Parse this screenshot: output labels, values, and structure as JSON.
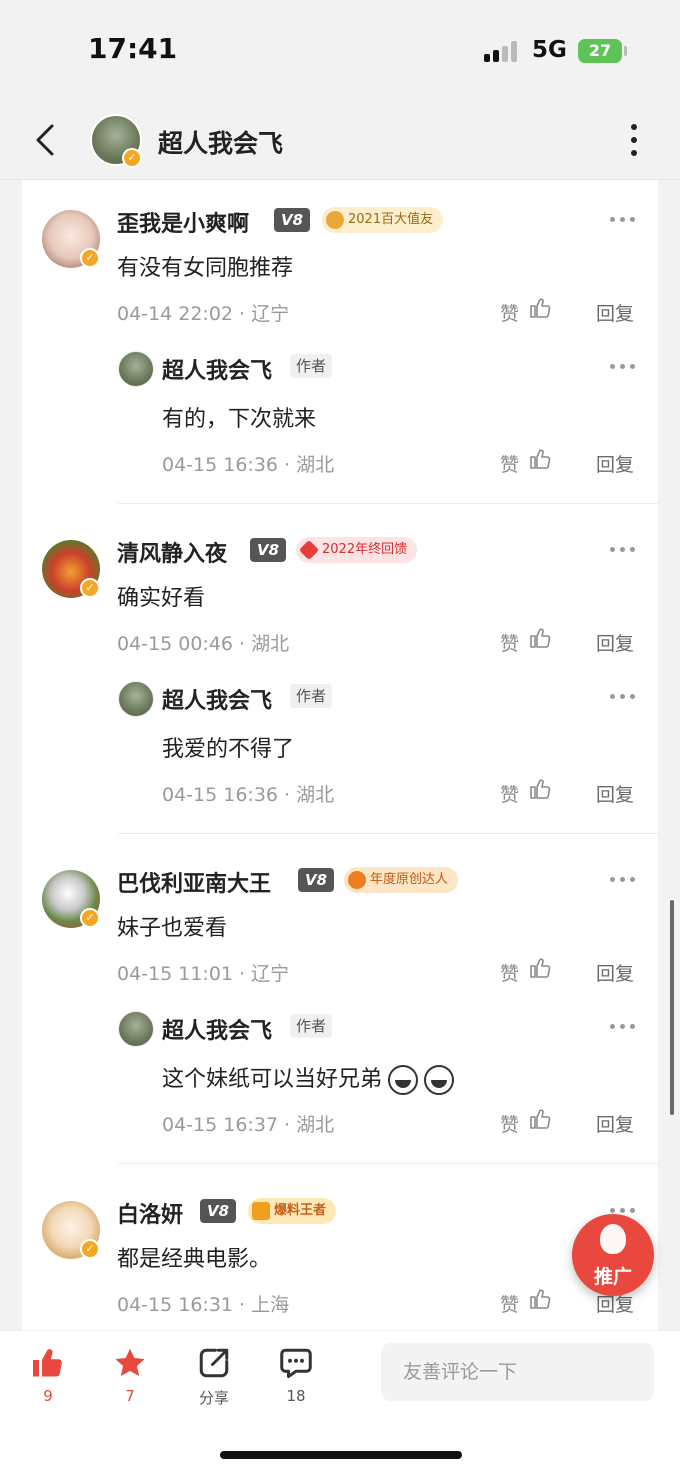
{
  "status_bar": {
    "time": "17:41",
    "network": "5G",
    "battery": "27"
  },
  "header": {
    "title": "超人我会飞"
  },
  "labels": {
    "author_tag": "作者",
    "like": "赞",
    "reply": "回复"
  },
  "comments": [
    {
      "name": "歪我是小爽啊",
      "level": "V8",
      "medal": "2021百大值友",
      "text": "有没有女同胞推荐",
      "time": "04-14 22:02",
      "location": "辽宁",
      "reply": {
        "name": "超人我会飞",
        "text": "有的，下次就来",
        "time": "04-15 16:36",
        "location": "湖北"
      }
    },
    {
      "name": "清风静入夜",
      "level": "V8",
      "medal": "2022年终回馈",
      "text": "确实好看",
      "time": "04-15 00:46",
      "location": "湖北",
      "reply": {
        "name": "超人我会飞",
        "text": "我爱的不得了",
        "time": "04-15 16:36",
        "location": "湖北"
      }
    },
    {
      "name": "巴伐利亚南大王",
      "level": "V8",
      "medal": "年度原创达人",
      "text": "妹子也爱看",
      "time": "04-15 11:01",
      "location": "辽宁",
      "reply": {
        "name": "超人我会飞",
        "text": "这个妹纸可以当好兄弟",
        "time": "04-15 16:37",
        "location": "湖北"
      }
    },
    {
      "name": "白洛妍",
      "level": "V8",
      "medal": "爆料王者",
      "text": "都是经典电影。",
      "time": "04-15 16:31",
      "location": "上海"
    }
  ],
  "fab": {
    "label": "推广"
  },
  "bottom_bar": {
    "like_count": "9",
    "favorite_count": "7",
    "share_label": "分享",
    "comment_count": "18",
    "input_placeholder": "友善评论一下"
  },
  "colors": {
    "accent": "#e8483d",
    "medal_gold": "#e8a838",
    "verified": "#f5a623"
  },
  "icons": [
    "back-icon",
    "more-vertical-icon",
    "more-horizontal-icon",
    "thumb-up-icon",
    "star-icon",
    "share-icon",
    "comment-icon"
  ]
}
